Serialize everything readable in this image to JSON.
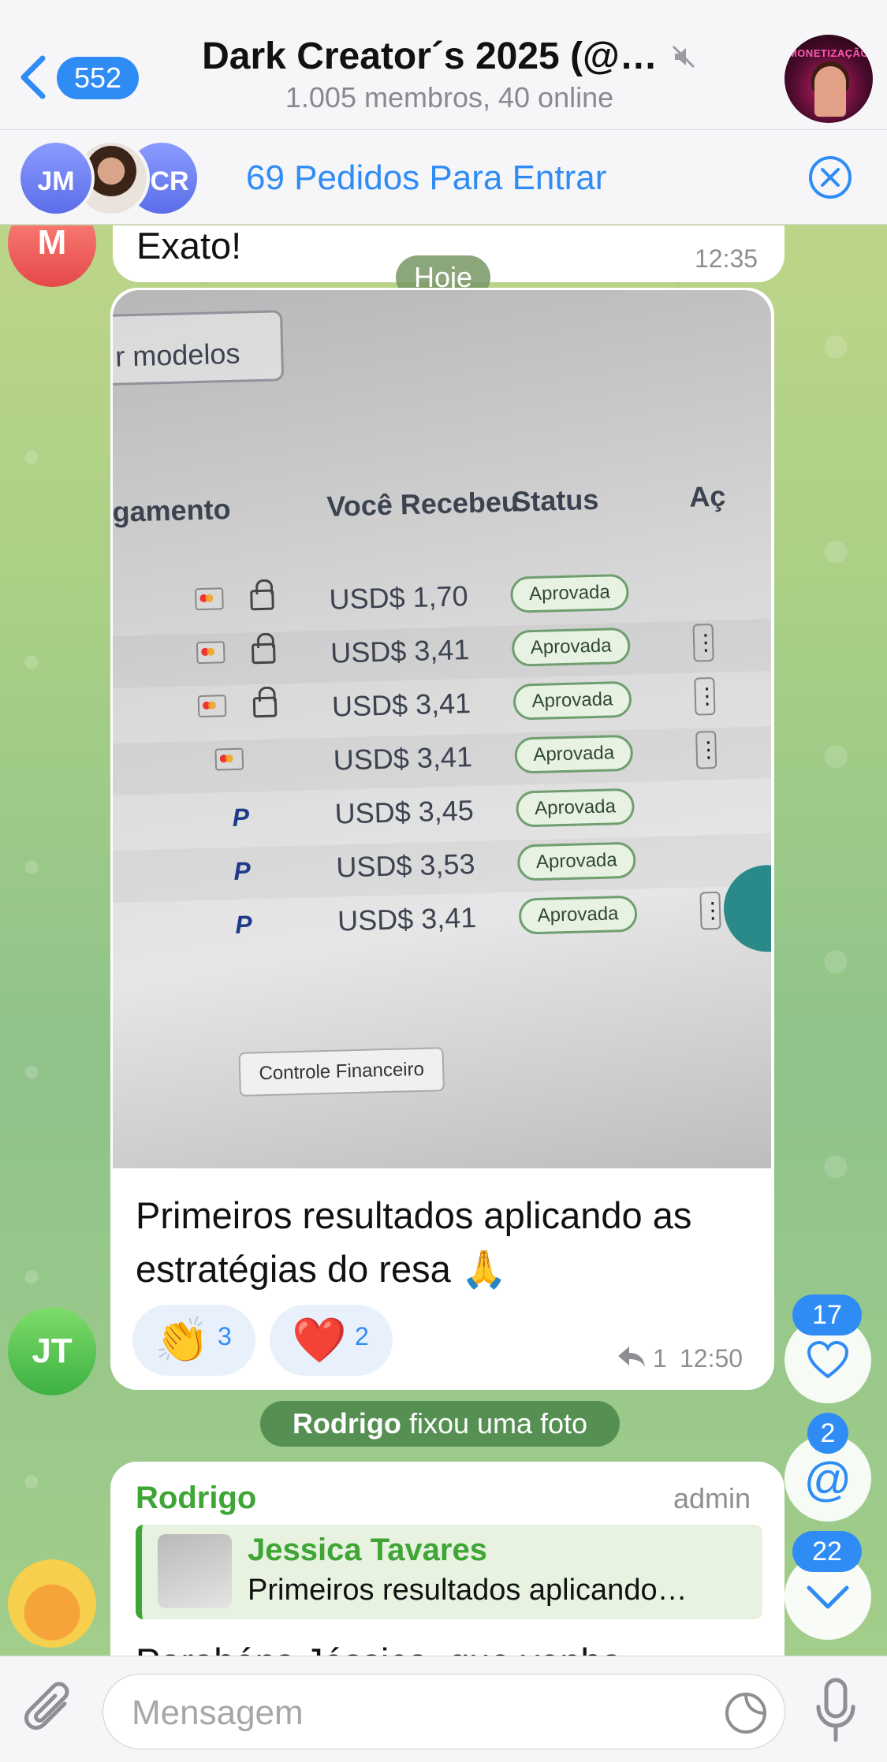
{
  "header": {
    "back_count": "552",
    "title": "Dark Creator´s 2025 (@…",
    "subtitle": "1.005 membros, 40 online",
    "avatar_label": "MONETIZAÇÃO"
  },
  "join_requests": {
    "avatars": [
      "JM",
      "CR"
    ],
    "text": "69 Pedidos Para Entrar"
  },
  "messages": {
    "top": {
      "avatar_initial": "M",
      "text": "Exato!",
      "time": "12:35"
    },
    "date_pill": "Hoje",
    "photo_message": {
      "avatar_initial": "JT",
      "photo": {
        "button_label": "r modelos",
        "columns": [
          "agamento",
          "Você Recebeu",
          "Status",
          "Aç"
        ],
        "rows": [
          {
            "method": "card",
            "amount": "USD$ 1,70",
            "status": "Aprovada"
          },
          {
            "method": "card",
            "amount": "USD$ 3,41",
            "status": "Aprovada"
          },
          {
            "method": "card",
            "amount": "USD$ 3,41",
            "status": "Aprovada"
          },
          {
            "method": "card",
            "amount": "USD$ 3,41",
            "status": "Aprovada"
          },
          {
            "method": "paypal",
            "amount": "USD$ 3,45",
            "status": "Aprovada"
          },
          {
            "method": "paypal",
            "amount": "USD$ 3,53",
            "status": "Aprovada"
          },
          {
            "method": "paypal",
            "amount": "USD$ 3,41",
            "status": "Aprovada"
          }
        ],
        "footer": "Controle Financeiro"
      },
      "caption": "Primeiros resultados aplicando as estratégias do resa 🙏",
      "reactions": [
        {
          "emoji": "👏",
          "count": "3"
        },
        {
          "emoji": "❤️",
          "count": "2"
        }
      ],
      "reply_count": "1",
      "time": "12:50"
    },
    "pinned_notice": {
      "name": "Rodrigo",
      "text": "fixou uma foto"
    },
    "reply_message": {
      "sender": "Rodrigo",
      "role": "admin",
      "quoted_name": "Jessica Tavares",
      "quoted_text": "Primeiros resultados aplicando…",
      "text": "Parabéns Jéssica, que venha"
    }
  },
  "side_buttons": {
    "reactions_count": "17",
    "mentions_count": "2",
    "unread_count": "22"
  },
  "input": {
    "placeholder": "Mensagem"
  },
  "colors": {
    "accent": "#2f8cf5",
    "sender_green": "#3fa535"
  }
}
